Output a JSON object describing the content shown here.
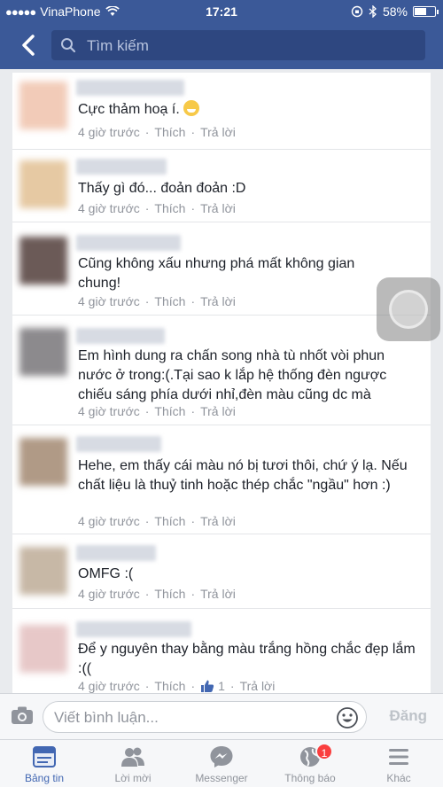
{
  "status_bar": {
    "carrier": "VinaPhone",
    "time": "17:21",
    "battery": "58%",
    "battery_level": 0.58
  },
  "nav": {
    "search_placeholder": "Tìm kiếm"
  },
  "comments": [
    {
      "text": "Cực thảm hoạ í.",
      "time": "4 giờ trước",
      "like": "Thích",
      "reply": "Trả lời",
      "avatar_color": "#f2cbb8",
      "has_emoji": true
    },
    {
      "text": "Thấy gì đó... đoản đoản :D",
      "time": "4 giờ trước",
      "like": "Thích",
      "reply": "Trả lời",
      "avatar_color": "#e6c9a3"
    },
    {
      "text": "Cũng không xấu nhưng phá mất không gian chung!",
      "time": "4 giờ trước",
      "like": "Thích",
      "reply": "Trả lời",
      "avatar_color": "#6b5a57"
    },
    {
      "text": "Em hình dung ra chấn song nhà tù nhốt vòi phun nước ở trong:(.Tại sao k lắp hệ thống đèn ngược chiếu sáng phía dưới nhỉ,đèn màu cũng dc mà",
      "time": "4 giờ trước",
      "like": "Thích",
      "reply": "Trả lời",
      "avatar_color": "#8c8a8d"
    },
    {
      "text": "Hehe, em thấy cái màu nó bị tươi thôi, chứ ý lạ. Nếu chất liệu là thuỷ tinh hoặc thép chắc \"ngầu\" hơn :)",
      "time": "4 giờ trước",
      "like": "Thích",
      "reply": "Trả lời",
      "avatar_color": "#b09a86"
    },
    {
      "text": "OMFG :(",
      "time": "4 giờ trước",
      "like": "Thích",
      "reply": "Trả lời",
      "avatar_color": "#c7b8a6"
    },
    {
      "text": "Để y nguyên thay bằng màu trắng hồng chắc đẹp lắm :((",
      "time": "4 giờ trước",
      "like": "Thích",
      "like_count": "1",
      "reply": "Trả lời",
      "avatar_color": "#e7c8c8"
    }
  ],
  "composer": {
    "placeholder": "Viết bình luận...",
    "post_label": "Đăng"
  },
  "tabs": [
    {
      "label": "Bảng tin",
      "icon": "news-feed-icon",
      "active": true
    },
    {
      "label": "Lời mời",
      "icon": "friend-requests-icon"
    },
    {
      "label": "Messenger",
      "icon": "messenger-icon"
    },
    {
      "label": "Thông báo",
      "icon": "globe-icon",
      "badge": "1"
    },
    {
      "label": "Khác",
      "icon": "menu-icon"
    }
  ],
  "colors": {
    "brand": "#3b5998",
    "active_tab": "#4267b2",
    "badge": "#fa3e3e"
  }
}
